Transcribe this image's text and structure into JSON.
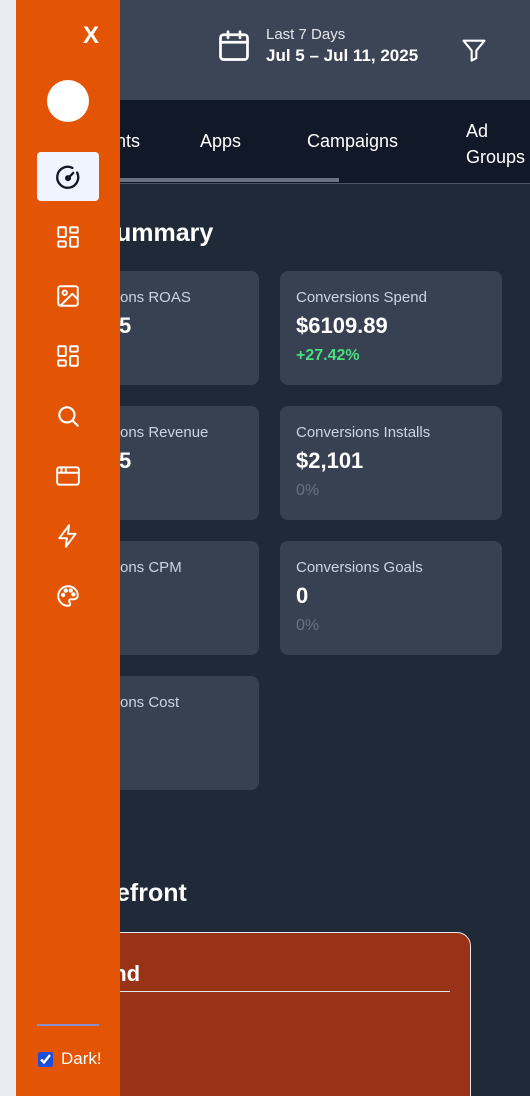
{
  "header": {
    "date_range_label": "Last 7 Days",
    "date_range_value": "Jul 5 – Jul 11, 2025",
    "calendar_icon": "calendar-icon",
    "filter_icon": "filter-icon"
  },
  "tabs": [
    {
      "label": "nts"
    },
    {
      "label": "Apps"
    },
    {
      "label": "Campaigns"
    },
    {
      "label": "Ad Groups",
      "line1": "Ad",
      "line2": "Groups"
    }
  ],
  "summary": {
    "title": "ummary",
    "cards": [
      {
        "label": "ons ROAS",
        "value": "",
        "change": ""
      },
      {
        "label": "Conversions Spend",
        "value": "$6109.89",
        "change": "+27.42%"
      },
      {
        "label": "ons Revenue",
        "value": "",
        "change": ""
      },
      {
        "label": "Conversions Installs",
        "value": "$2,101",
        "change": "0%"
      },
      {
        "label": "ons CPM",
        "value": "",
        "change": ""
      },
      {
        "label": "Conversions Goals",
        "value": "0",
        "change": "0%"
      },
      {
        "label": "ons Cost",
        "value": "",
        "change": ""
      }
    ]
  },
  "storefront": {
    "title": "efront",
    "card_title": "end"
  },
  "sidebar": {
    "close_label": "X",
    "items": [
      {
        "icon": "gauge-icon",
        "active": true
      },
      {
        "icon": "dashboard-grid-icon"
      },
      {
        "icon": "image-icon"
      },
      {
        "icon": "layout-grid-icon"
      },
      {
        "icon": "search-icon"
      },
      {
        "icon": "browser-window-icon"
      },
      {
        "icon": "lightning-icon"
      },
      {
        "icon": "palette-icon"
      }
    ],
    "dark_label": "Dark!",
    "dark_checked": true
  },
  "colors": {
    "sidebar": "#e35505",
    "background": "#1f2937",
    "card": "#374151",
    "positive": "#4ade80"
  }
}
